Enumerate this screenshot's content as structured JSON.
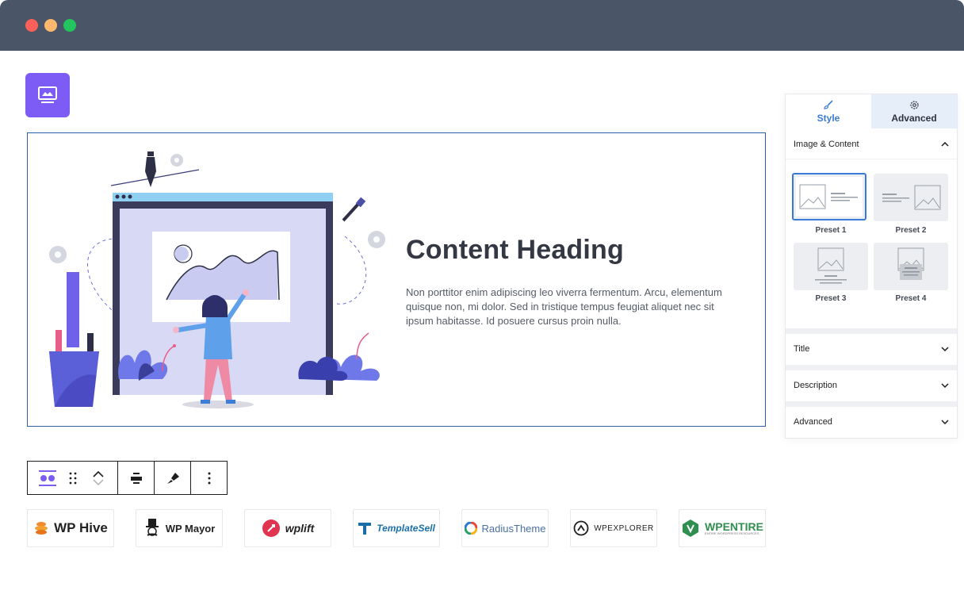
{
  "window": {
    "controls": [
      "close",
      "minimize",
      "maximize"
    ]
  },
  "block_icon": {
    "name": "image-content-block-icon",
    "color": "#7c5cf4"
  },
  "content": {
    "heading": "Content Heading",
    "description": "Non porttitor enim adipiscing leo viverra fermentum. Arcu, elementum quisque non, mi dolor. Sed in tristique tempus feugiat aliquet nec sit ipsum habitasse. Id posuere cursus proin nulla."
  },
  "toolbar": {
    "buttons": [
      "block-type",
      "drag-handle",
      "move-up-down",
      "align",
      "style-brush",
      "more-options"
    ]
  },
  "logos": [
    {
      "text": "WP Hive"
    },
    {
      "text": "WP Mayor"
    },
    {
      "text": "wplift"
    },
    {
      "text": "TemplateSell"
    },
    {
      "text": "RadiusTheme"
    },
    {
      "text": "WPEXPLORER"
    },
    {
      "text": "WPENTIRE",
      "subtext": "ENTIRE WORDPRESS RESOURCES"
    }
  ],
  "panel": {
    "tabs": [
      {
        "label": "Style",
        "icon": "brush-icon",
        "active": true
      },
      {
        "label": "Advanced",
        "icon": "gear-icon",
        "active": false
      }
    ],
    "sections": {
      "image_content": "Image & Content",
      "title": "Title",
      "description": "Description",
      "advanced": "Advanced"
    },
    "presets": [
      "Preset 1",
      "Preset 2",
      "Preset 3",
      "Preset 4"
    ],
    "selected_preset": "Preset 1"
  },
  "colors": {
    "accent": "#3a7bd5",
    "brand": "#7c5cf4",
    "titlebar": "#4a5568"
  }
}
